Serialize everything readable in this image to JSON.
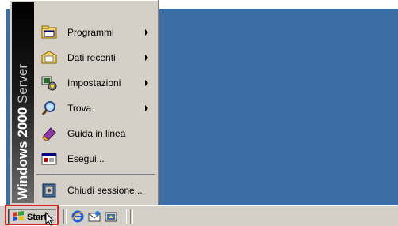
{
  "banner": {
    "brand": "Windows 2000",
    "edition": "Server"
  },
  "menu": {
    "items": [
      {
        "label": "Programmi",
        "icon": "programs-icon",
        "has_submenu": true
      },
      {
        "label": "Dati recenti",
        "icon": "documents-icon",
        "has_submenu": true
      },
      {
        "label": "Impostazioni",
        "icon": "settings-icon",
        "has_submenu": true
      },
      {
        "label": "Trova",
        "icon": "search-icon",
        "has_submenu": true
      },
      {
        "label": "Guida in linea",
        "icon": "help-icon",
        "has_submenu": false
      },
      {
        "label": "Esegui...",
        "icon": "run-icon",
        "has_submenu": false
      }
    ],
    "shutdown": {
      "label": "Chiudi sessione...",
      "icon": "logoff-icon"
    }
  },
  "taskbar": {
    "start_label": "Start",
    "quick_launch": [
      "internet-explorer-icon",
      "outlook-express-icon",
      "show-desktop-icon"
    ]
  },
  "colors": {
    "desktop": "#3a6ea5",
    "menu_bg": "#d4d0c8",
    "highlight": "#e0232b"
  }
}
